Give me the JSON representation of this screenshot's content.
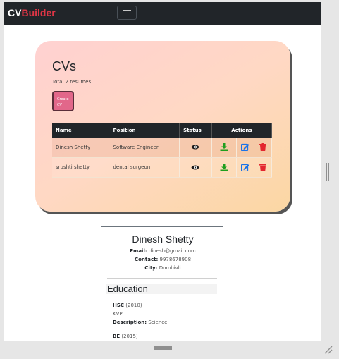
{
  "navbar": {
    "brand_prefix": "CV",
    "brand_suffix": "Builder"
  },
  "cvs": {
    "title": "CVs",
    "subtitle": "Total 2 resumes",
    "create_label_1": "Create",
    "create_label_2": "CV",
    "columns": [
      "Name",
      "Position",
      "Status",
      "Actions"
    ],
    "rows": [
      {
        "name": "Dinesh Shetty",
        "position": "Software Engineer"
      },
      {
        "name": "srushti shetty",
        "position": "dental surgeon"
      }
    ]
  },
  "preview": {
    "name": "Dinesh Shetty",
    "email_label": "Email:",
    "email": "dinesh@gmail.com",
    "contact_label": "Contact:",
    "contact": "9978678908",
    "city_label": "City:",
    "city": "Dombivli",
    "education_heading": "Education",
    "edu": [
      {
        "degree": "HSC",
        "year": "(2010)",
        "school": "KVP",
        "desc_label": "Description:",
        "desc": "Science"
      },
      {
        "degree": "BE",
        "year": "(2015)"
      }
    ]
  },
  "colors": {
    "navbar": "#212529",
    "brand_accent": "#dc3545",
    "download": "#1e9e1e",
    "edit": "#1a73e8",
    "delete": "#e3262f"
  },
  "icons": {
    "status": "eye-icon",
    "download": "download-icon",
    "edit": "edit-icon",
    "delete": "trash-icon"
  }
}
